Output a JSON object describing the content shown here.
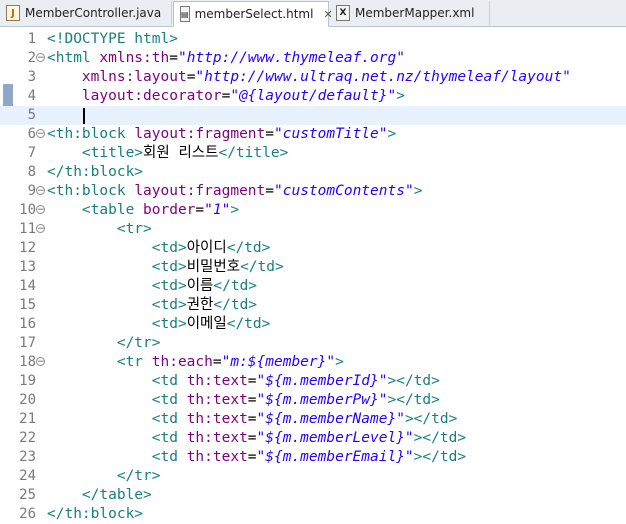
{
  "tabs": [
    {
      "label": "MemberController.java",
      "icon": "java-file-icon",
      "active": false
    },
    {
      "label": "memberSelect.html",
      "icon": "html-file-icon",
      "active": true,
      "close": "✕"
    },
    {
      "label": "MemberMapper.xml",
      "icon": "xml-file-icon",
      "active": false
    }
  ],
  "lines": [
    {
      "n": "1",
      "fold": "",
      "tokens": [
        [
          "tag",
          "<!DOCTYPE html>"
        ]
      ]
    },
    {
      "n": "2",
      "fold": "minus",
      "tokens": [
        [
          "tag",
          "<html "
        ],
        [
          "attr",
          "xmlns:th"
        ],
        [
          "text",
          "="
        ],
        [
          "val",
          "\"http://www.thymeleaf.org\""
        ]
      ]
    },
    {
      "n": "3",
      "fold": "",
      "tokens": [
        [
          "text",
          "    "
        ],
        [
          "attr",
          "xmlns:layout"
        ],
        [
          "text",
          "="
        ],
        [
          "val",
          "\"http://www.ultraq.net.nz/thymeleaf/layout\""
        ]
      ]
    },
    {
      "n": "4",
      "fold": "",
      "tokens": [
        [
          "text",
          "    "
        ],
        [
          "attr",
          "layout:decorator"
        ],
        [
          "text",
          "="
        ],
        [
          "val",
          "\"@{layout/default}\""
        ],
        [
          "tag",
          ">"
        ]
      ]
    },
    {
      "n": "5",
      "fold": "",
      "current": true,
      "tokens": []
    },
    {
      "n": "6",
      "fold": "minus",
      "tokens": [
        [
          "tag",
          "<th:block "
        ],
        [
          "attr",
          "layout:fragment"
        ],
        [
          "text",
          "="
        ],
        [
          "val",
          "\"customTitle\""
        ],
        [
          "tag",
          ">"
        ]
      ]
    },
    {
      "n": "7",
      "fold": "",
      "tokens": [
        [
          "text",
          "    "
        ],
        [
          "tag",
          "<title>"
        ],
        [
          "text",
          "회원 리스트"
        ],
        [
          "tag",
          "</title>"
        ]
      ]
    },
    {
      "n": "8",
      "fold": "",
      "tokens": [
        [
          "tag",
          "</th:block>"
        ]
      ]
    },
    {
      "n": "9",
      "fold": "minus",
      "tokens": [
        [
          "tag",
          "<th:block "
        ],
        [
          "attr",
          "layout:fragment"
        ],
        [
          "text",
          "="
        ],
        [
          "val",
          "\"customContents\""
        ],
        [
          "tag",
          ">"
        ]
      ]
    },
    {
      "n": "10",
      "fold": "minus",
      "tokens": [
        [
          "text",
          "    "
        ],
        [
          "tag",
          "<table "
        ],
        [
          "attr",
          "border"
        ],
        [
          "text",
          "="
        ],
        [
          "val",
          "\"1\""
        ],
        [
          "tag",
          ">"
        ]
      ]
    },
    {
      "n": "11",
      "fold": "minus",
      "tokens": [
        [
          "text",
          "        "
        ],
        [
          "tag",
          "<tr>"
        ]
      ]
    },
    {
      "n": "12",
      "fold": "",
      "tokens": [
        [
          "text",
          "            "
        ],
        [
          "tag",
          "<td>"
        ],
        [
          "text",
          "아이디"
        ],
        [
          "tag",
          "</td>"
        ]
      ]
    },
    {
      "n": "13",
      "fold": "",
      "tokens": [
        [
          "text",
          "            "
        ],
        [
          "tag",
          "<td>"
        ],
        [
          "text",
          "비밀번호"
        ],
        [
          "tag",
          "</td>"
        ]
      ]
    },
    {
      "n": "14",
      "fold": "",
      "tokens": [
        [
          "text",
          "            "
        ],
        [
          "tag",
          "<td>"
        ],
        [
          "text",
          "이름"
        ],
        [
          "tag",
          "</td>"
        ]
      ]
    },
    {
      "n": "15",
      "fold": "",
      "tokens": [
        [
          "text",
          "            "
        ],
        [
          "tag",
          "<td>"
        ],
        [
          "text",
          "권한"
        ],
        [
          "tag",
          "</td>"
        ]
      ]
    },
    {
      "n": "16",
      "fold": "",
      "tokens": [
        [
          "text",
          "            "
        ],
        [
          "tag",
          "<td>"
        ],
        [
          "text",
          "이메일"
        ],
        [
          "tag",
          "</td>"
        ]
      ]
    },
    {
      "n": "17",
      "fold": "",
      "tokens": [
        [
          "text",
          "        "
        ],
        [
          "tag",
          "</tr>"
        ]
      ]
    },
    {
      "n": "18",
      "fold": "minus",
      "tokens": [
        [
          "text",
          "        "
        ],
        [
          "tag",
          "<tr "
        ],
        [
          "attr",
          "th:each"
        ],
        [
          "text",
          "="
        ],
        [
          "val",
          "\"m:${member}\""
        ],
        [
          "tag",
          ">"
        ]
      ]
    },
    {
      "n": "19",
      "fold": "",
      "tokens": [
        [
          "text",
          "            "
        ],
        [
          "tag",
          "<td "
        ],
        [
          "attr",
          "th:text"
        ],
        [
          "text",
          "="
        ],
        [
          "val",
          "\"${m.memberId}\""
        ],
        [
          "tag",
          "></td>"
        ]
      ]
    },
    {
      "n": "20",
      "fold": "",
      "tokens": [
        [
          "text",
          "            "
        ],
        [
          "tag",
          "<td "
        ],
        [
          "attr",
          "th:text"
        ],
        [
          "text",
          "="
        ],
        [
          "val",
          "\"${m.memberPw}\""
        ],
        [
          "tag",
          "></td>"
        ]
      ]
    },
    {
      "n": "21",
      "fold": "",
      "tokens": [
        [
          "text",
          "            "
        ],
        [
          "tag",
          "<td "
        ],
        [
          "attr",
          "th:text"
        ],
        [
          "text",
          "="
        ],
        [
          "val",
          "\"${m.memberName}\""
        ],
        [
          "tag",
          "></td>"
        ]
      ]
    },
    {
      "n": "22",
      "fold": "",
      "tokens": [
        [
          "text",
          "            "
        ],
        [
          "tag",
          "<td "
        ],
        [
          "attr",
          "th:text"
        ],
        [
          "text",
          "="
        ],
        [
          "val",
          "\"${m.memberLevel}\""
        ],
        [
          "tag",
          "></td>"
        ]
      ]
    },
    {
      "n": "23",
      "fold": "",
      "tokens": [
        [
          "text",
          "            "
        ],
        [
          "tag",
          "<td "
        ],
        [
          "attr",
          "th:text"
        ],
        [
          "text",
          "="
        ],
        [
          "val",
          "\"${m.memberEmail}\""
        ],
        [
          "tag",
          "></td>"
        ]
      ]
    },
    {
      "n": "24",
      "fold": "",
      "tokens": [
        [
          "text",
          "        "
        ],
        [
          "tag",
          "</tr>"
        ]
      ]
    },
    {
      "n": "25",
      "fold": "",
      "tokens": [
        [
          "text",
          "    "
        ],
        [
          "tag",
          "</table>"
        ]
      ]
    },
    {
      "n": "26",
      "fold": "",
      "tokens": [
        [
          "tag",
          "</th:block>"
        ]
      ]
    }
  ],
  "colors": {
    "tag": "#17807e",
    "attr": "#7f007f",
    "value": "#2a00ff",
    "current_line": "#e8f2fe"
  }
}
